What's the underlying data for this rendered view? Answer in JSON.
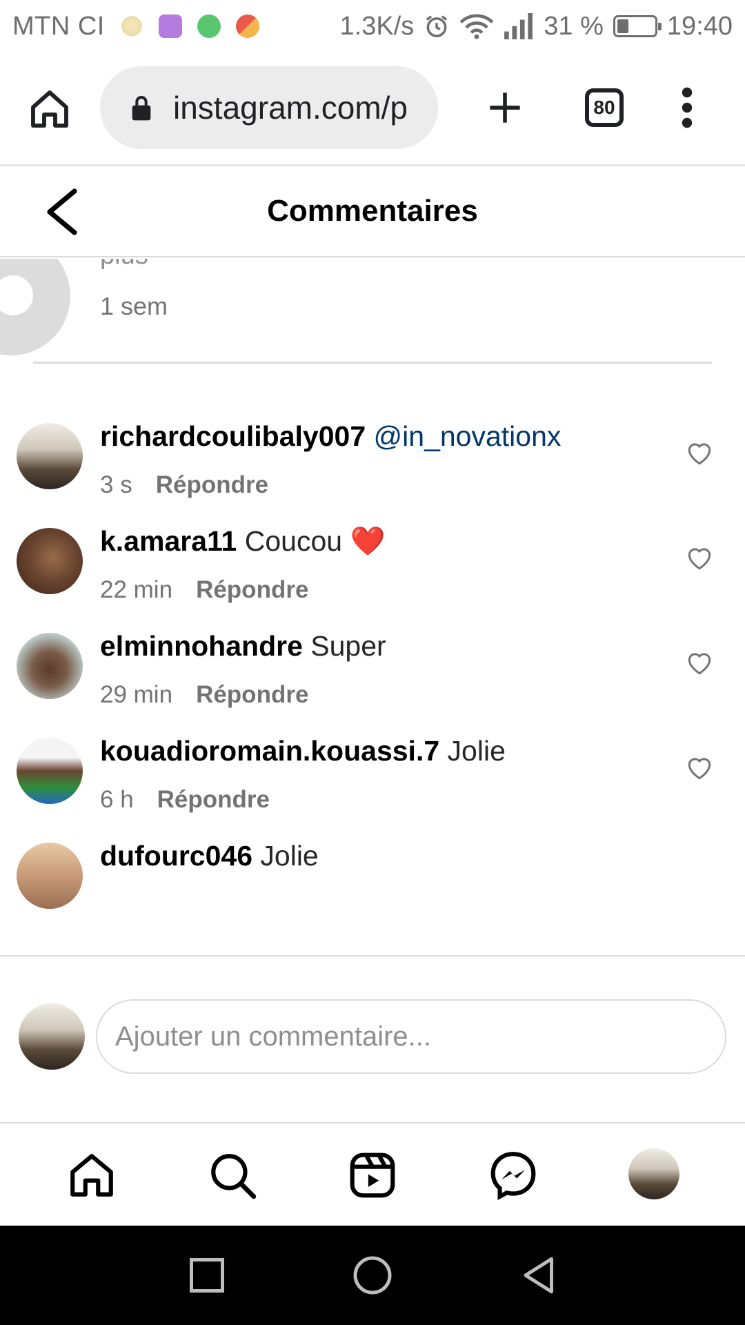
{
  "status_bar": {
    "carrier": "MTN CI",
    "speed": "1.3K/s",
    "battery_text": "31 %",
    "battery_level": 0.31,
    "time": "19:40",
    "notification_icons": [
      "emblem-icon",
      "gallery-icon",
      "whatsapp-icon",
      "gmail-icon"
    ]
  },
  "browser": {
    "url": "instagram.com/p",
    "tab_count": "80",
    "icons": [
      "home-icon",
      "lock-icon",
      "plus-icon",
      "tabs-icon",
      "overflow-menu-icon"
    ]
  },
  "header": {
    "title": "Commentaires",
    "back_icon": "chevron-left-icon"
  },
  "partial_comment": {
    "text": "plus",
    "time": "1 sem"
  },
  "comments": [
    {
      "username": "richardcoulibaly007",
      "mention": "@in_novationx",
      "text": "",
      "time": "3 s",
      "reply_label": "Répondre"
    },
    {
      "username": "k.amara11",
      "mention": "",
      "text": "Coucou ❤️",
      "time": "22 min",
      "reply_label": "Répondre"
    },
    {
      "username": "elminnohandre",
      "mention": "",
      "text": "Super",
      "time": "29 min",
      "reply_label": "Répondre"
    },
    {
      "username": "kouadioromain.kouassi.7",
      "mention": "",
      "text": "Jolie",
      "time": "6 h",
      "reply_label": "Répondre"
    },
    {
      "username": "dufourc046",
      "mention": "",
      "text": "Jolie",
      "time": "",
      "reply_label": ""
    }
  ],
  "composer": {
    "placeholder": "Ajouter un commentaire..."
  },
  "bottom_nav": [
    "home-icon",
    "search-icon",
    "reels-icon",
    "messenger-icon",
    "profile-avatar"
  ],
  "system_nav": [
    "recents-square-icon",
    "home-circle-icon",
    "back-triangle-icon"
  ],
  "colors": {
    "mention": "#00376b",
    "meta_text": "#737373",
    "divider": "#dbdbdb"
  }
}
